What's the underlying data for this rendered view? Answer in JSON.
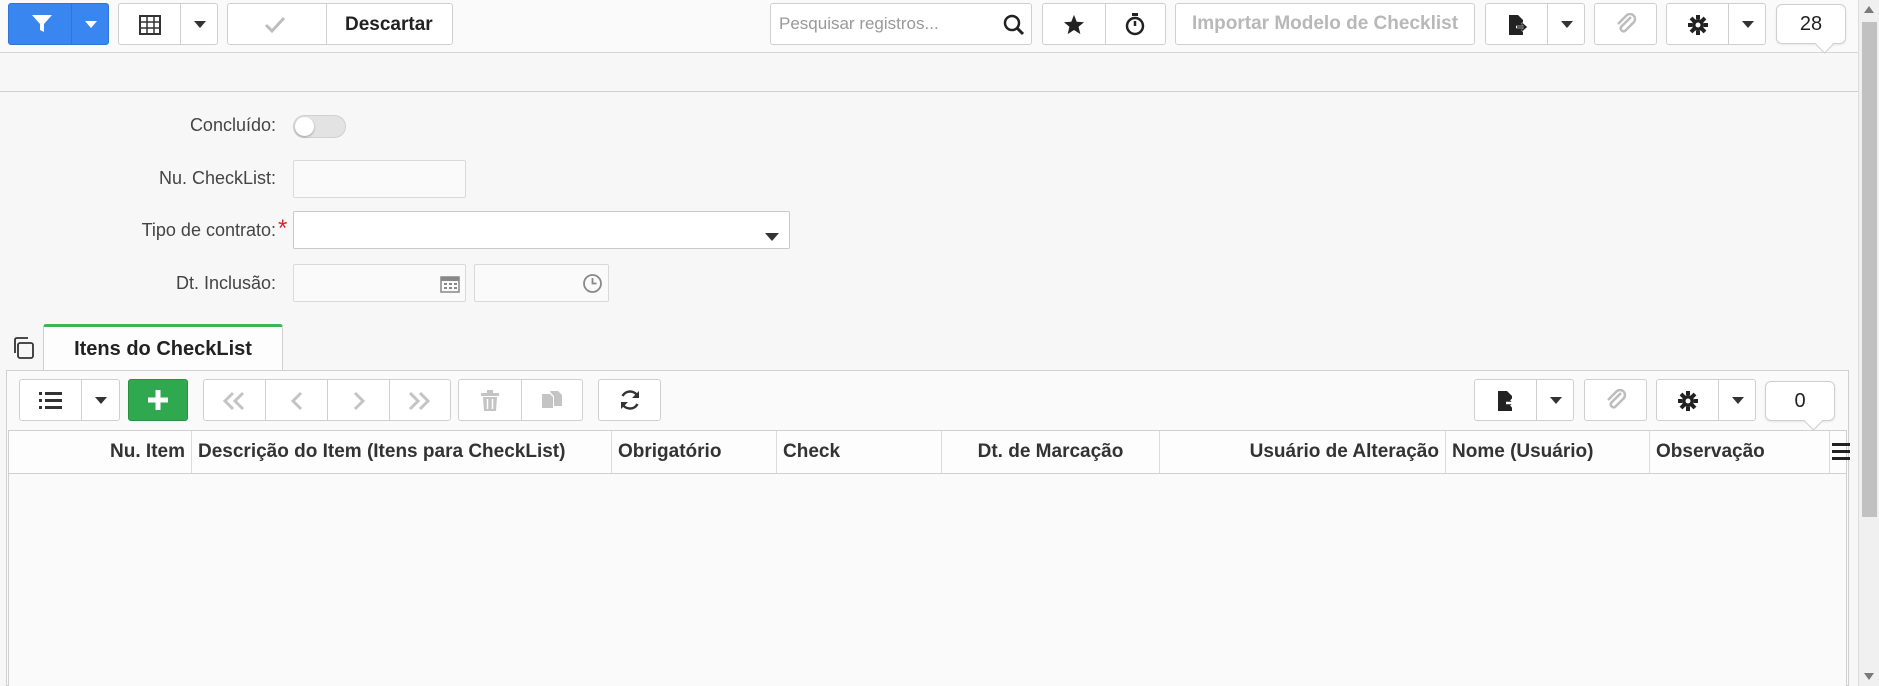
{
  "toolbar": {
    "discard_label": "Descartar",
    "search_placeholder": "Pesquisar registros...",
    "import_label": "Importar Modelo de Checklist",
    "record_count": "28"
  },
  "form": {
    "concluido_label": "Concluído:",
    "nu_checklist_label": "Nu. CheckList:",
    "tipo_contrato_label": "Tipo de contrato:",
    "required_marker": "*",
    "dt_inclusao_label": "Dt. Inclusão:"
  },
  "tab": {
    "label": "Itens do CheckList"
  },
  "grid_toolbar": {
    "record_count": "0"
  },
  "grid": {
    "columns": [
      "Nu. Item",
      "Descrição do Item (Itens para CheckList)",
      "Obrigatório",
      "Check",
      "Dt. de Marcação",
      "Usuário de Alteração",
      "Nome (Usuário)",
      "Observação"
    ]
  },
  "colors": {
    "primary": "#3a86f0",
    "success": "#2fa84f",
    "tab_accent": "#3cb553",
    "required": "#d9262b"
  }
}
